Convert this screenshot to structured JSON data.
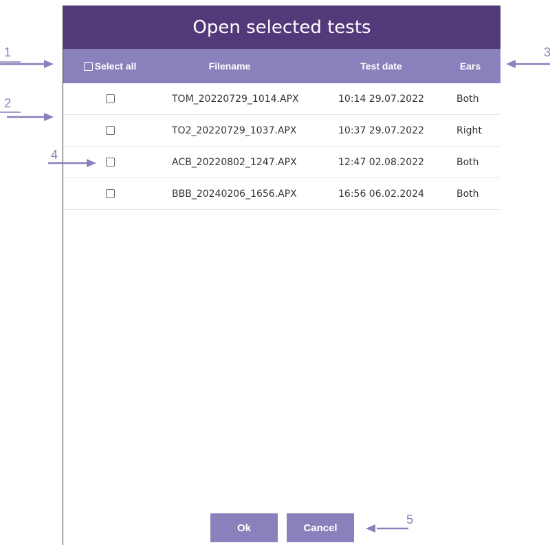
{
  "dialog": {
    "title": "Open selected tests",
    "header": {
      "select_all": "Select all",
      "filename": "Filename",
      "test_date": "Test date",
      "ears": "Ears"
    },
    "rows": [
      {
        "filename": "TOM_20220729_1014.APX",
        "test_date": "10:14 29.07.2022",
        "ears": "Both",
        "checked": false
      },
      {
        "filename": "TO2_20220729_1037.APX",
        "test_date": "10:37 29.07.2022",
        "ears": "Right",
        "checked": false
      },
      {
        "filename": "ACB_20220802_1247.APX",
        "test_date": "12:47 02.08.2022",
        "ears": "Both",
        "checked": false
      },
      {
        "filename": "BBB_20240206_1656.APX",
        "test_date": "16:56 06.02.2024",
        "ears": "Both",
        "checked": false
      }
    ],
    "buttons": {
      "ok": "Ok",
      "cancel": "Cancel"
    }
  },
  "callouts": {
    "c1": "1",
    "c2": "2",
    "c3": "3",
    "c4": "4",
    "c5": "5"
  },
  "colors": {
    "title_bar": "#523a7a",
    "header_row": "#8a80bb",
    "annotation": "#8a80bb"
  }
}
